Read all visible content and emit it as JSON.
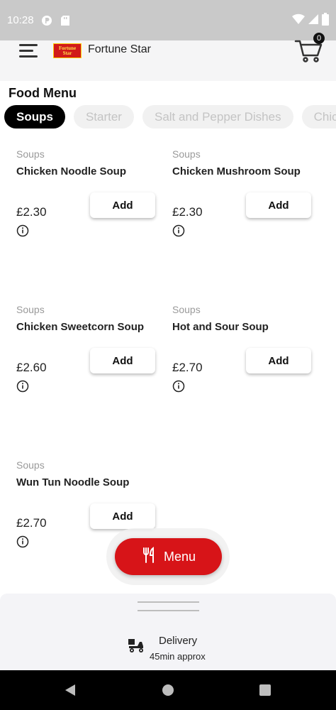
{
  "status_bar": {
    "time": "10:28"
  },
  "header": {
    "restaurant_name": "Fortune Star",
    "logo_text": "Fortune Star",
    "cart_count": "0"
  },
  "menu": {
    "title": "Food Menu",
    "tabs": [
      "Soups",
      "Starter",
      "Salt and Pepper Dishes",
      "Chic"
    ],
    "active_tab": "Soups",
    "add_label": "Add",
    "items": [
      {
        "category": "Soups",
        "name": "Chicken Noodle Soup",
        "price": "£2.30"
      },
      {
        "category": "Soups",
        "name": "Chicken Mushroom Soup",
        "price": "£2.30"
      },
      {
        "category": "Soups",
        "name": "Chicken Sweetcorn Soup",
        "price": "£2.60"
      },
      {
        "category": "Soups",
        "name": "Hot and Sour Soup",
        "price": "£2.70"
      },
      {
        "category": "Soups",
        "name": "Wun Tun Noodle Soup",
        "price": "£2.70"
      }
    ]
  },
  "fab": {
    "label": "Menu"
  },
  "delivery": {
    "label": "Delivery",
    "time": "45min approx"
  },
  "colors": {
    "accent_red": "#d71418",
    "active_tab": "#000000",
    "header_bg": "#f5f5f6"
  }
}
